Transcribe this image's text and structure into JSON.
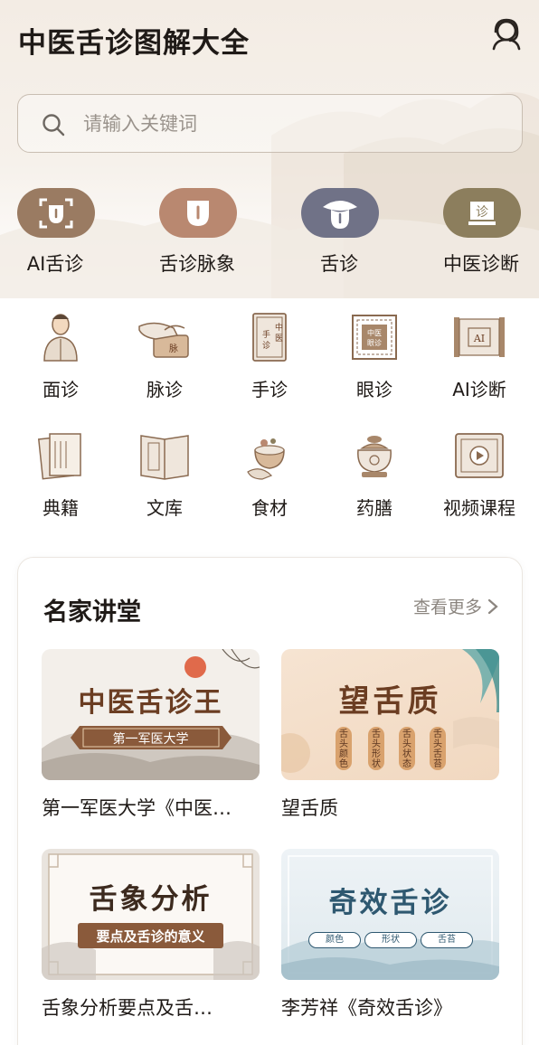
{
  "app": {
    "title": "中医舌诊图解大全"
  },
  "search": {
    "placeholder": "请输入关键词"
  },
  "top_categories": [
    {
      "label": "AI舌诊",
      "icon": "ai-tongue-scan-icon",
      "color": "#9a7b62"
    },
    {
      "label": "舌诊脉象",
      "icon": "tongue-icon",
      "color": "#b98870"
    },
    {
      "label": "舌诊",
      "icon": "mouth-tongue-icon",
      "color": "#707287"
    },
    {
      "label": "中医诊断",
      "icon": "diagnosis-book-icon",
      "color": "#8c7e5d"
    }
  ],
  "grid_items": [
    {
      "label": "面诊",
      "icon": "face-diagnosis-icon"
    },
    {
      "label": "脉诊",
      "icon": "pulse-diagnosis-icon"
    },
    {
      "label": "手诊",
      "icon": "hand-diagnosis-book-icon"
    },
    {
      "label": "眼诊",
      "icon": "eye-diagnosis-icon"
    },
    {
      "label": "AI诊断",
      "icon": "ai-diagnosis-scroll-icon"
    },
    {
      "label": "典籍",
      "icon": "classics-books-icon"
    },
    {
      "label": "文库",
      "icon": "library-book-icon"
    },
    {
      "label": "食材",
      "icon": "ingredients-icon"
    },
    {
      "label": "药膳",
      "icon": "medicinal-diet-pot-icon"
    },
    {
      "label": "视频课程",
      "icon": "video-course-icon"
    }
  ],
  "lectures": {
    "title": "名家讲堂",
    "see_more": "查看更多",
    "courses": [
      {
        "title": "第一军医大学《中医…",
        "thumb_title": "中医舌诊王",
        "thumb_sub": "第一军医大学"
      },
      {
        "title": "望舌质",
        "thumb_title": "望舌质",
        "thumb_tags": [
          "舌头颜色",
          "舌头形状",
          "舌头状态",
          "舌头舌苔"
        ]
      },
      {
        "title": "舌象分析要点及舌…",
        "thumb_title": "舌象分析",
        "thumb_sub": "要点及舌诊的意义"
      },
      {
        "title": "李芳祥《奇效舌诊》",
        "thumb_title": "奇效舌诊",
        "thumb_tags": [
          "颜色",
          "形状",
          "舌苔"
        ]
      }
    ]
  },
  "colors": {
    "accent_brown": "#8a5a3b",
    "title_brown": "#6b3d22",
    "text_dark": "#1f1a17"
  }
}
